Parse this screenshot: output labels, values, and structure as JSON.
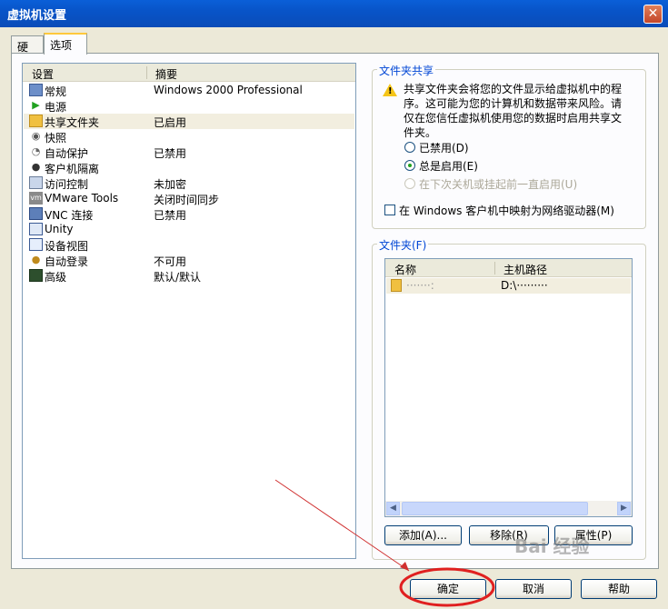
{
  "window": {
    "title": "虚拟机设置",
    "close_glyph": "✕"
  },
  "tabs": [
    {
      "label": "硬件"
    },
    {
      "label": "选项"
    }
  ],
  "settings_list": {
    "col_setting": "设置",
    "col_summary": "摘要",
    "rows": [
      {
        "name": "常规",
        "summary": "Windows 2000 Professional",
        "icon": "monitor-icon"
      },
      {
        "name": "电源",
        "summary": "",
        "icon": "play-icon"
      },
      {
        "name": "共享文件夹",
        "summary": "已启用",
        "icon": "folder-icon"
      },
      {
        "name": "快照",
        "summary": "",
        "icon": "camera-icon"
      },
      {
        "name": "自动保护",
        "summary": "已禁用",
        "icon": "clock-icon"
      },
      {
        "name": "客户机隔离",
        "summary": "",
        "icon": "user-icon"
      },
      {
        "name": "访问控制",
        "summary": "未加密",
        "icon": "lock-icon"
      },
      {
        "name": "VMware Tools",
        "summary": "关闭时间同步",
        "icon": "vm-icon"
      },
      {
        "name": "VNC 连接",
        "summary": "已禁用",
        "icon": "monitor-icon"
      },
      {
        "name": "Unity",
        "summary": "",
        "icon": "window-icon"
      },
      {
        "name": "设备视图",
        "summary": "",
        "icon": "device-icon"
      },
      {
        "name": "自动登录",
        "summary": "不可用",
        "icon": "login-icon"
      },
      {
        "name": "高级",
        "summary": "默认/默认",
        "icon": "chart-icon"
      }
    ]
  },
  "share_group": {
    "legend": "文件夹共享",
    "warning": "共享文件夹会将您的文件显示给虚拟机中的程序。这可能为您的计算机和数据带来风险。请仅在您信任虚拟机使用您的数据时启用共享文件夹。",
    "options": [
      {
        "label": "已禁用(D)"
      },
      {
        "label": "总是启用(E)"
      },
      {
        "label": "在下次关机或挂起前一直启用(U)"
      }
    ],
    "map_drive_label": "在 Windows 客户机中映射为网络驱动器(M)"
  },
  "folders_group": {
    "legend": "文件夹(F)",
    "col_name": "名称",
    "col_path": "主机路径",
    "rows": [
      {
        "name": "·······:",
        "path": "D:\\·········"
      }
    ],
    "add_label": "添加(A)...",
    "remove_label": "移除(R)",
    "properties_label": "属性(P)"
  },
  "footer": {
    "ok_label": "确定",
    "cancel_label": "取消",
    "help_label": "帮助"
  },
  "watermark_text": "Bai 经验"
}
